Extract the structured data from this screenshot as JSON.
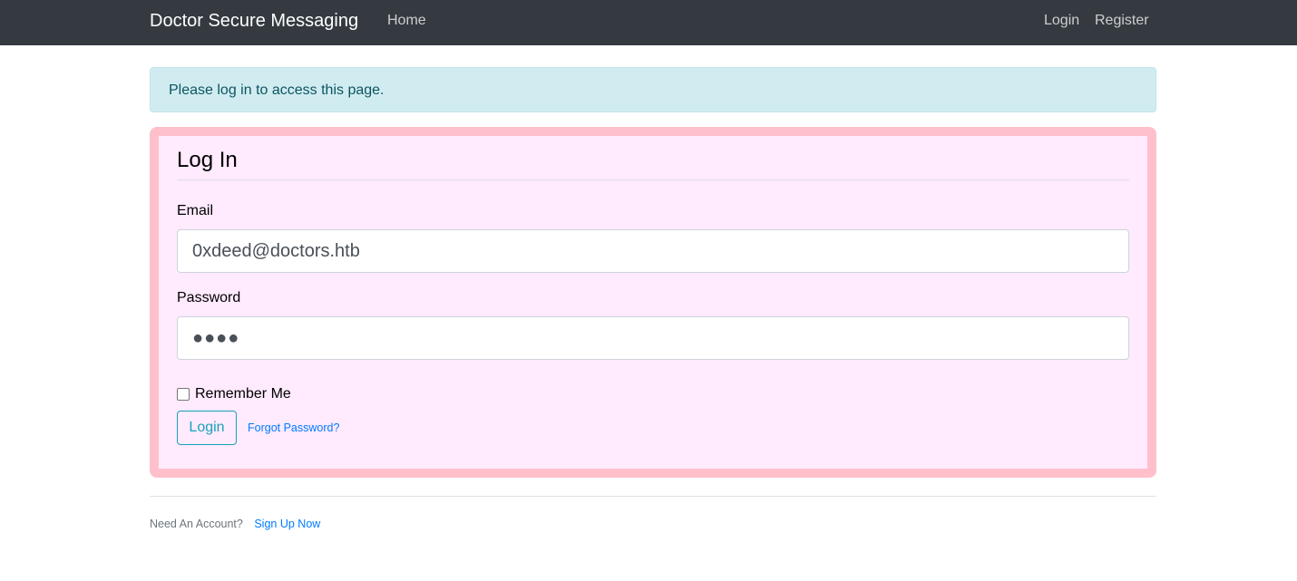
{
  "navbar": {
    "brand": "Doctor Secure Messaging",
    "home": "Home",
    "login": "Login",
    "register": "Register"
  },
  "alert": {
    "message": "Please log in to access this page."
  },
  "form": {
    "legend": "Log In",
    "email_label": "Email",
    "email_value": "0xdeed@doctors.htb",
    "password_label": "Password",
    "password_value": "●●●●",
    "remember_label": "Remember Me",
    "remember_checked": false,
    "submit_label": "Login",
    "forgot_link": "Forgot Password?"
  },
  "footer": {
    "prompt": "Need An Account?",
    "signup_link": "Sign Up Now"
  },
  "colors": {
    "navbar_bg": "#343a40",
    "alert_bg": "#d1ecf1",
    "card_border": "#ffc0cb",
    "card_bg": "#ffeafe",
    "accent": "#17a2b8",
    "link": "#007bff"
  }
}
